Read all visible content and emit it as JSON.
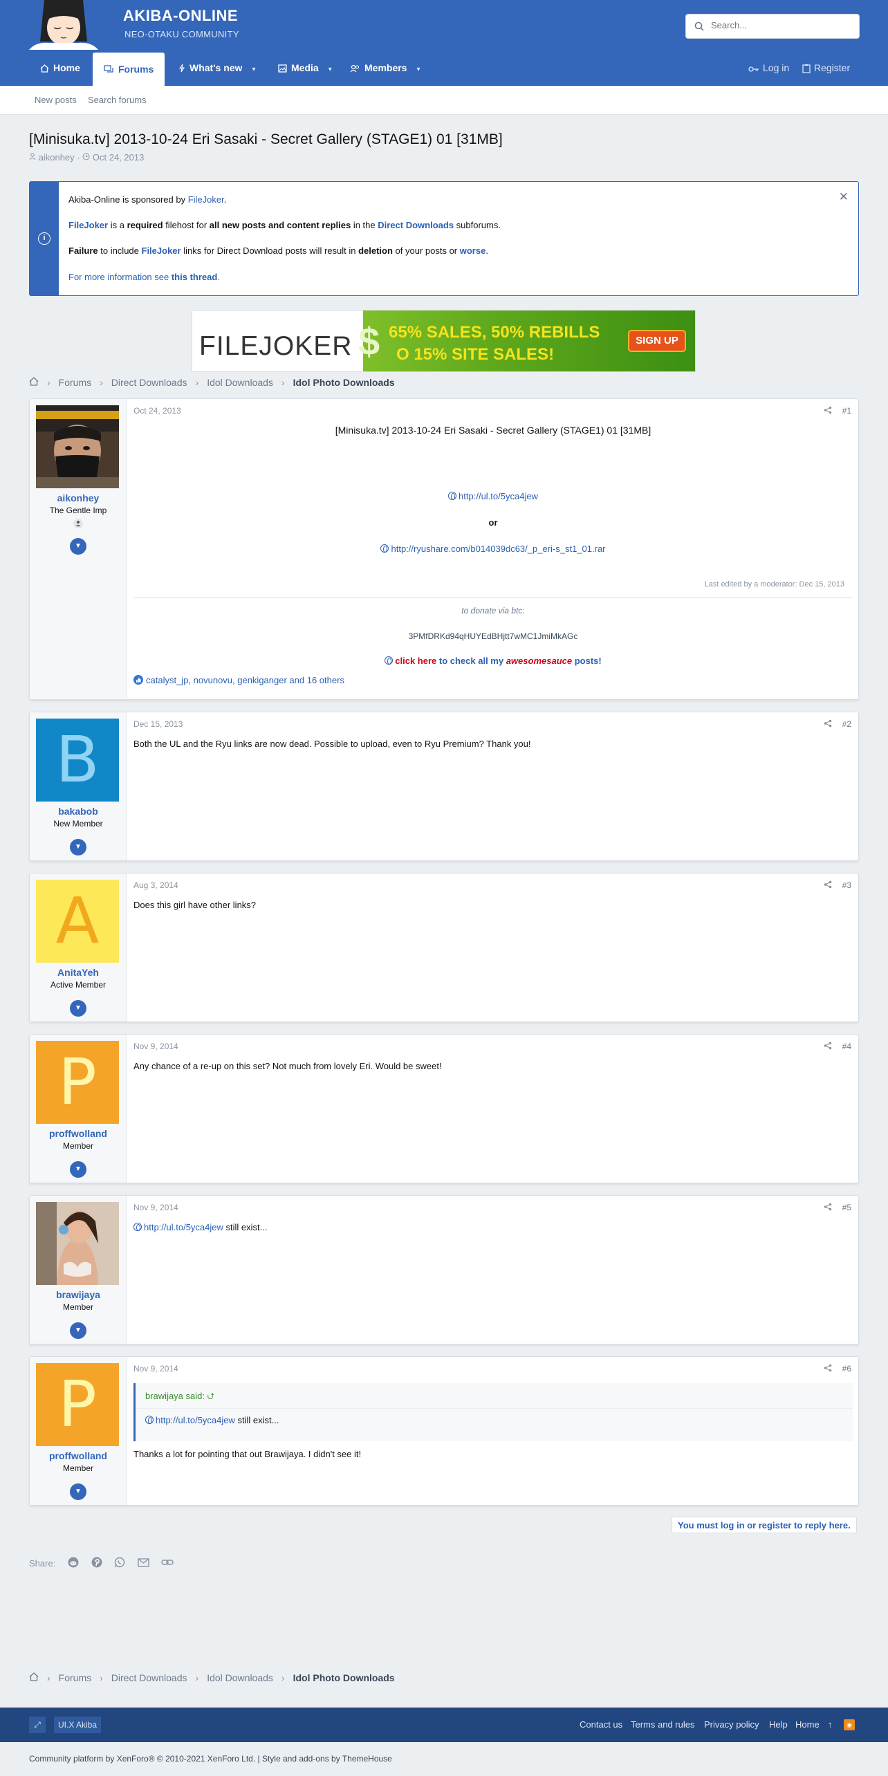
{
  "header": {
    "site_title": "AKIBA-ONLINE",
    "site_subtitle": "NEO-OTAKU COMMUNITY",
    "search_placeholder": "Search..."
  },
  "nav": {
    "home": "Home",
    "forums": "Forums",
    "whats_new": "What's new",
    "media": "Media",
    "members": "Members",
    "login": "Log in",
    "register": "Register"
  },
  "subnav": {
    "new_posts": "New posts",
    "search_forums": "Search forums"
  },
  "thread": {
    "title": "[Minisuka.tv] 2013-10-24 Eri Sasaki - Secret Gallery (STAGE1) 01 [31MB]",
    "author": "aikonhey",
    "date": "Oct 24, 2013"
  },
  "notice": {
    "line1_pre": "Akiba-Online is sponsored by ",
    "line1_link": "FileJoker",
    "line1_post": ".",
    "line2_link": "FileJoker",
    "line2_a": " is a ",
    "line2_b": "required",
    "line2_c": " filehost for ",
    "line2_d": "all new posts and content replies",
    "line2_e": " in the ",
    "line2_link2": "Direct Downloads",
    "line2_f": " subforums.",
    "line3_a": "Failure",
    "line3_b": " to include ",
    "line3_link": "FileJoker",
    "line3_c": " links for Direct Download posts will result in ",
    "line3_d": "deletion",
    "line3_e": " of your posts or ",
    "line3_link2": "worse",
    "line3_f": ".",
    "line4_a": "For more information see ",
    "line4_link": "this thread",
    "line4_b": "."
  },
  "banner": {
    "logo_text": "FILEJOKER",
    "dollar": "$",
    "line1": "65% SALES, 50% REBILLS",
    "line2": "O 15% SITE SALES!",
    "button": "SIGN UP"
  },
  "breadcrumb": [
    "Forums",
    "Direct Downloads",
    "Idol Downloads",
    "Idol Photo Downloads"
  ],
  "posts": [
    {
      "num": "#1",
      "date": "Oct 24, 2013",
      "user": "aikonhey",
      "title": "The Gentle Imp",
      "heading": "[Minisuka.tv] 2013-10-24 Eri Sasaki - Secret Gallery (STAGE1) 01 [31MB]",
      "link1": "http://ul.to/5yca4jew",
      "or": "or",
      "link2": "http://ryushare.com/b014039dc63/_p_eri-s_st1_01.rar",
      "edited": "Last edited by a moderator: Dec 15, 2013",
      "donate": "to donate via btc:",
      "btc": "3PMfDRKd94qHUYEdBHjtt7wMC1JmiMkAGc",
      "sig_red": "click here",
      "sig_blue": " to check all my ",
      "sig_em": "awesomesauce",
      "sig_end": " posts!",
      "likes": "catalyst_jp, novunovu, genkiganger and 16 others"
    },
    {
      "num": "#2",
      "date": "Dec 15, 2013",
      "user": "bakabob",
      "title": "New Member",
      "letter": "B",
      "body": "Both the UL and the Ryu links are now dead. Possible to upload, even to Ryu Premium? Thank you!"
    },
    {
      "num": "#3",
      "date": "Aug 3, 2014",
      "user": "AnitaYeh",
      "title": "Active Member",
      "letter": "A",
      "body": "Does this girl have other links?"
    },
    {
      "num": "#4",
      "date": "Nov 9, 2014",
      "user": "proffwolland",
      "title": "Member",
      "letter": "P",
      "body": "Any chance of a re-up on this set? Not much from lovely Eri. Would be sweet!"
    },
    {
      "num": "#5",
      "date": "Nov 9, 2014",
      "user": "brawijaya",
      "title": "Member",
      "link": "http://ul.to/5yca4jew",
      "body": " still exist..."
    },
    {
      "num": "#6",
      "date": "Nov 9, 2014",
      "user": "proffwolland",
      "title": "Member",
      "letter": "P",
      "quote_author": "brawijaya said:",
      "quote_link": "http://ul.to/5yca4jew",
      "quote_body": " still exist...",
      "body": "Thanks a lot for pointing that out Brawijaya. I didn't see it!"
    }
  ],
  "reply_notice": "You must log in or register to reply here.",
  "share_label": "Share:",
  "footer": {
    "style_name": "UI.X Akiba",
    "links": [
      "Contact us",
      "Terms and rules",
      "Privacy policy",
      "Help",
      "Home"
    ],
    "copyright": "Community platform by XenForo® © 2010-2021 XenForo Ltd. | Style and add-ons by ThemeHouse"
  },
  "colors": {
    "brand": "#3466b9",
    "footer": "#22467f",
    "link": "#2b61b3"
  }
}
